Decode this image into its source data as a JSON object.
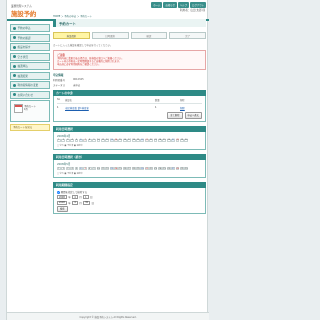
{
  "header": {
    "sub": "業務管理システム",
    "logo": "施設予約",
    "links": [
      "ホーム",
      "お知らせ",
      "ヘルプ",
      "ログアウト"
    ],
    "user": "利用者：山田 太郎 様"
  },
  "sidebar": {
    "items": [
      "予約の申込",
      "予約の確認",
      "施設を探す",
      "空き状況",
      "抽選申込",
      "抽選結果",
      "利用者情報の変更",
      "お問い合わせ"
    ],
    "panel": [
      "予約カート",
      "1件"
    ],
    "yellow": "予約カートを見る"
  },
  "main": {
    "breadcrumb": "HOME ＞ 予約の申込 ＞ 予約カート",
    "title": "予約カート",
    "steps": [
      "施設選択",
      "日時選択",
      "確認",
      "完了"
    ],
    "intro": "カートに入った施設を確認して申込を行ってください。",
    "notice_title": "ご注意",
    "notice_lines": [
      "予約内容に変更がある場合は、各施設の窓口へご連絡ください。",
      "カート内の予約は一定時間経過すると自動的に削除されます。",
      "申込前に必ず利用規約をご確認ください。"
    ],
    "info_title": "申込情報",
    "info_rows": [
      [
        "利用者番号",
        "0012345"
      ],
      [
        "ステータス",
        "未申込"
      ]
    ]
  },
  "cart": {
    "title": "カートの中身",
    "headers": [
      "No",
      "施設名",
      "数量",
      "削除"
    ],
    "rows": [
      [
        "1",
        "市民体育館 第1体育室",
        "1",
        "削除"
      ]
    ],
    "btn_delete": "全て削除",
    "btn_apply": "申込へ進む"
  },
  "dates1": {
    "title": "利用日時選択",
    "label": "2008年4月",
    "days": [
      "1",
      "2",
      "3",
      "4",
      "5",
      "6",
      "7",
      "8",
      "9",
      "10",
      "11",
      "12",
      "13",
      "14",
      "15",
      "16",
      "17",
      "18",
      "19",
      "20",
      "21",
      "22",
      "23",
      "24",
      "25",
      "26",
      "27",
      "28",
      "29",
      "30"
    ],
    "legend": "□ 空き  ■ 予約済  ■ 選択中"
  },
  "dates2": {
    "title": "利用日時選択（続き）",
    "label": "2008年5月",
    "days": [
      "1",
      "2",
      "3",
      "4",
      "5",
      "6",
      "7",
      "8",
      "9",
      "10",
      "11",
      "12",
      "13",
      "14",
      "15",
      "16",
      "17",
      "18",
      "19",
      "20",
      "21",
      "22",
      "23",
      "24",
      "25",
      "26",
      "27",
      "28",
      "29",
      "30"
    ],
    "legend": "□ 空き  ■ 予約済  ■ 選択中"
  },
  "period": {
    "title": "利用期間指定",
    "check_label": "期間を指定して検索する",
    "from_year": "2008",
    "from_month": "4",
    "from_day": "1",
    "to_year": "2008",
    "to_month": "4",
    "to_day": "30",
    "year_unit": "年",
    "month_unit": "月",
    "day_unit": "日",
    "button": "検索"
  },
  "footer": "Copyright © 施設予約システム All Rights Reserved."
}
